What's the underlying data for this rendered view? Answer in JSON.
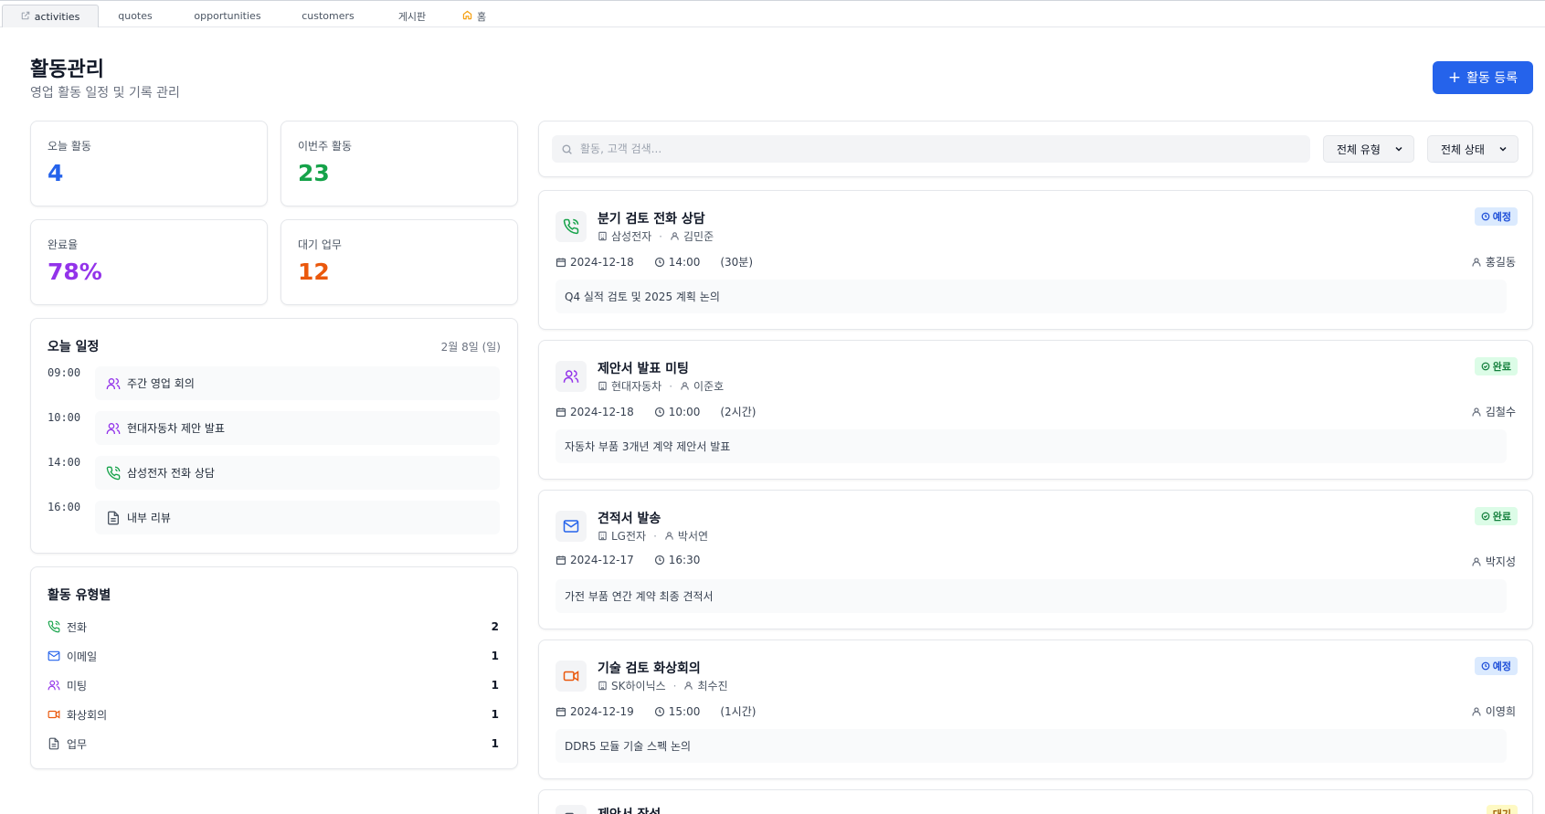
{
  "tabs": [
    {
      "label": "activities",
      "active": true,
      "icon": "external-link-icon"
    },
    {
      "label": "quotes"
    },
    {
      "label": "opportunities"
    },
    {
      "label": "customers"
    },
    {
      "label": "게시판"
    },
    {
      "label": "홈",
      "icon": "home-icon"
    }
  ],
  "header": {
    "title": "활동관리",
    "subtitle": "영업 활동 일정 및 기록 관리",
    "add_button_label": "활동 등록"
  },
  "stats": [
    {
      "label": "오늘 활동",
      "value": "4",
      "color": "#2563eb"
    },
    {
      "label": "이번주 활동",
      "value": "23",
      "color": "#16a34a"
    },
    {
      "label": "완료율",
      "value": "78%",
      "color": "#9333ea"
    },
    {
      "label": "대기 업무",
      "value": "12",
      "color": "#ea580c"
    }
  ],
  "schedule": {
    "title": "오늘 일정",
    "date": "2월 8일 (일)",
    "items": [
      {
        "time": "09:00",
        "label": "주간 영업 회의",
        "icon": "users-icon"
      },
      {
        "time": "10:00",
        "label": "현대자동차 제안 발표",
        "icon": "users-icon"
      },
      {
        "time": "14:00",
        "label": "삼성전자 전화 상담",
        "icon": "phone-icon"
      },
      {
        "time": "16:00",
        "label": "내부 리뷰",
        "icon": "document-icon"
      }
    ]
  },
  "types": {
    "title": "활동 유형별",
    "items": [
      {
        "label": "전화",
        "count": "2",
        "icon": "phone-icon"
      },
      {
        "label": "이메일",
        "count": "1",
        "icon": "mail-icon"
      },
      {
        "label": "미팅",
        "count": "1",
        "icon": "users-icon"
      },
      {
        "label": "화상회의",
        "count": "1",
        "icon": "video-icon"
      },
      {
        "label": "업무",
        "count": "1",
        "icon": "document-icon"
      }
    ]
  },
  "filters": {
    "search_placeholder": "활동, 고객 검색...",
    "type_select": "전체 유형",
    "status_select": "전체 상태"
  },
  "activities": [
    {
      "title": "분기 검토 전화 상담",
      "company": "삼성전자",
      "contact": "김민준",
      "date": "2024-12-18",
      "time": "14:00",
      "duration": "(30분)",
      "owner": "홍길동",
      "note": "Q4 실적 검토 및 2025 계획 논의",
      "status": "예정",
      "icon": "phone-icon"
    },
    {
      "title": "제안서 발표 미팅",
      "company": "현대자동차",
      "contact": "이준호",
      "date": "2024-12-18",
      "time": "10:00",
      "duration": "(2시간)",
      "owner": "김철수",
      "note": "자동차 부품 3개년 계약 제안서 발표",
      "status": "완료",
      "icon": "users-icon"
    },
    {
      "title": "견적서 발송",
      "company": "LG전자",
      "contact": "박서연",
      "date": "2024-12-17",
      "time": "16:30",
      "duration": "",
      "owner": "박지성",
      "note": "가전 부품 연간 계약 최종 견적서",
      "status": "완료",
      "icon": "mail-icon"
    },
    {
      "title": "기술 검토 화상회의",
      "company": "SK하이닉스",
      "contact": "최수진",
      "date": "2024-12-19",
      "time": "15:00",
      "duration": "(1시간)",
      "owner": "이영희",
      "note": "DDR5 모듈 기술 스펙 논의",
      "status": "예정",
      "icon": "video-icon"
    },
    {
      "title": "제안서 작성",
      "status": "대기",
      "icon": "document-icon"
    }
  ],
  "colors": {
    "primary": "#2563eb",
    "phone": "#16a34a",
    "mail": "#2563eb",
    "meeting": "#9333ea",
    "video": "#ea580c",
    "task": "#4b5563",
    "status_planned_bg": "#dbeafe",
    "status_planned_fg": "#1d4ed8",
    "status_done_bg": "#dcfce7",
    "status_done_fg": "#15803d",
    "status_wait_bg": "#fef9c3",
    "status_wait_fg": "#a16207"
  }
}
